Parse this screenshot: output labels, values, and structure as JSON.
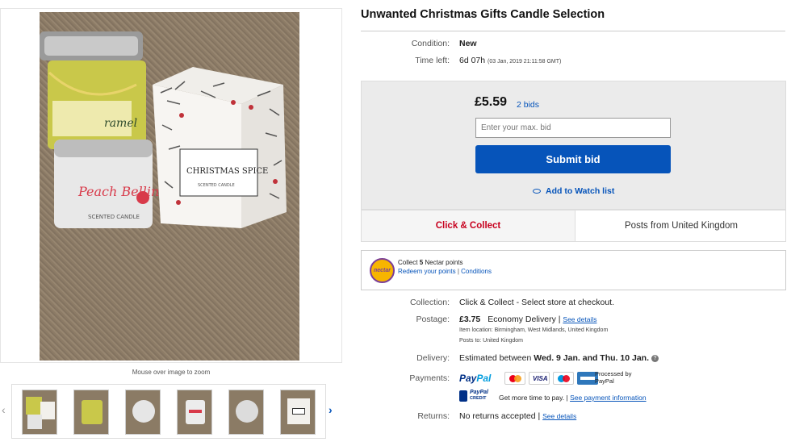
{
  "listing": {
    "title": "Unwanted Christmas Gifts Candle Selection",
    "condition_label": "Condition:",
    "condition_value": "New",
    "time_left_label": "Time left:",
    "time_left_value": "6d 07h",
    "time_left_detail": "(03 Jan, 2019  21:11:58 GMT)"
  },
  "gallery": {
    "zoom_hint": "Mouse over image to zoom",
    "main_image_labels": [
      "Peach Bellini",
      "SCENTED CANDLE",
      "CHRISTMAS SPICE",
      "SCENTED CANDLE",
      "ramel"
    ],
    "thumbnail_count": 6
  },
  "bid": {
    "price": "£5.59",
    "bids": "2 bids",
    "input_placeholder": "Enter your max. bid",
    "submit_label": "Submit bid",
    "watch_label": "Add to Watch list"
  },
  "delivery_options": {
    "click_collect": "Click & Collect",
    "posts_from": "Posts from United Kingdom"
  },
  "nectar": {
    "logo_text": "nectar",
    "line1_prefix": "Collect",
    "points": "5",
    "line1_suffix": "Nectar points",
    "redeem": "Redeem your points",
    "separator": "|",
    "conditions": "Conditions"
  },
  "details": {
    "collection_label": "Collection:",
    "collection_value": "Click & Collect - Select store at checkout.",
    "postage_label": "Postage:",
    "postage_price": "£3.75",
    "postage_service": "Economy Delivery",
    "separator": "|",
    "see_details": "See details",
    "item_location": "Item location:  Birmingham, West Midlands, United Kingdom",
    "posts_to": "Posts to:  United Kingdom",
    "delivery_label": "Delivery:",
    "delivery_prefix": "Estimated between",
    "delivery_dates": "Wed. 9 Jan. and Thu. 10 Jan.",
    "help_icon_text": "?",
    "payments_label": "Payments:",
    "paypal_pay": "Pay",
    "paypal_pal": "Pal",
    "processed_by": "Processed by PayPal",
    "paypal_credit_1": "PayPal",
    "paypal_credit_2": "CREDIT",
    "more_time": "Get more time to pay.",
    "see_payment": "See payment information",
    "returns_label": "Returns:",
    "returns_value": "No returns accepted",
    "returns_see_details": "See details"
  },
  "colors": {
    "ebay_blue": "#0654ba",
    "click_collect_red": "#c7001e",
    "bid_panel_bg": "#ebebeb",
    "nectar_purple": "#7b3f98",
    "nectar_yellow": "#f7b500"
  },
  "icons": [
    "eye-icon",
    "help-icon",
    "mastercard-icon",
    "visa-icon",
    "maestro-icon",
    "amex-icon",
    "chevron-left-icon",
    "chevron-right-icon"
  ]
}
